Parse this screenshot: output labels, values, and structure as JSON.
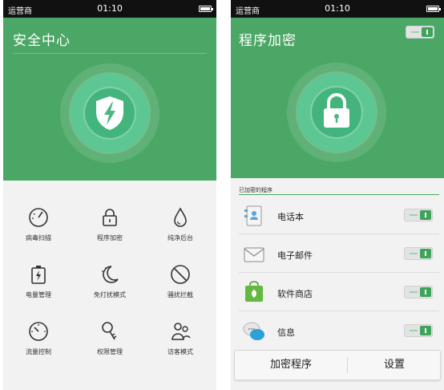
{
  "security_center": {
    "status_bar": {
      "carrier": "运营商",
      "time": "01:10"
    },
    "title": "安全中心",
    "features": [
      {
        "label": "病毒扫描",
        "icon": "virus-scan-gauge-icon"
      },
      {
        "label": "程序加密",
        "icon": "padlock-icon"
      },
      {
        "label": "纯净后台",
        "icon": "water-drop-icon"
      },
      {
        "label": "电量管理",
        "icon": "battery-bolt-icon"
      },
      {
        "label": "免打扰模式",
        "icon": "moon-stars-icon"
      },
      {
        "label": "骚扰拦截",
        "icon": "block-icon"
      },
      {
        "label": "流量控制",
        "icon": "speedometer-icon"
      },
      {
        "label": "权限管理",
        "icon": "key-icon"
      },
      {
        "label": "访客模式",
        "icon": "visitor-people-icon"
      }
    ]
  },
  "app_lock": {
    "status_bar": {
      "carrier": "运营商",
      "time": "01:10"
    },
    "title": "程序加密",
    "master_toggle_on": true,
    "section_label": "已加密的程序",
    "apps": [
      {
        "name": "电话本",
        "icon": "contacts-book-icon",
        "locked": true
      },
      {
        "name": "电子邮件",
        "icon": "envelope-icon",
        "locked": true
      },
      {
        "name": "软件商店",
        "icon": "app-store-bag-icon",
        "locked": true
      },
      {
        "name": "信息",
        "icon": "chat-bubbles-icon",
        "locked": true
      }
    ],
    "buttons": {
      "encrypt": "加密程序",
      "settings": "设置"
    }
  },
  "colors": {
    "brand_green": "#4ba765",
    "toggle_green": "#3ea35b",
    "circle_green": "#5dc793"
  }
}
